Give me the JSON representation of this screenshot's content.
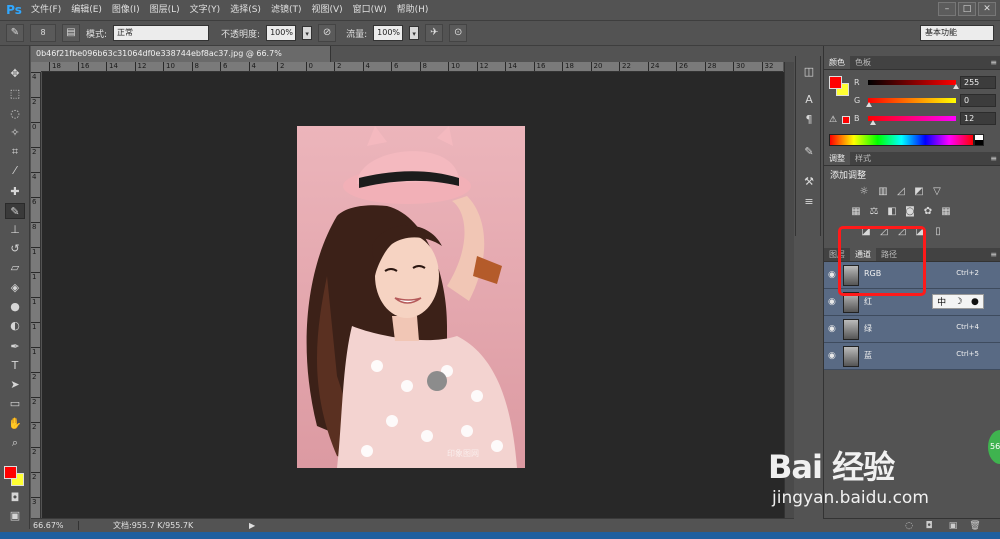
{
  "app": {
    "logo": "Ps"
  },
  "menu": [
    "文件(F)",
    "编辑(E)",
    "图像(I)",
    "图层(L)",
    "文字(Y)",
    "选择(S)",
    "滤镜(T)",
    "视图(V)",
    "窗口(W)",
    "帮助(H)"
  ],
  "window_controls": [
    "–",
    "□",
    "✕"
  ],
  "options": {
    "brush_size": "8",
    "mode_label": "模式:",
    "mode_value": "正常",
    "opacity_label": "不透明度:",
    "opacity_value": "100%",
    "flow_label": "流量:",
    "flow_value": "100%",
    "workspace": "基本功能"
  },
  "document": {
    "tab_title": "0b46f21fbe096b63c31064df0e338744ebf8ac37.jpg @ 66.7%(RGB/8#)",
    "tab_close": "×",
    "ruler_h": [
      "18",
      "16",
      "14",
      "12",
      "10",
      "8",
      "6",
      "4",
      "2",
      "0",
      "2",
      "4",
      "6",
      "8",
      "10",
      "12",
      "14",
      "16",
      "18",
      "20",
      "22",
      "24",
      "26",
      "28",
      "30",
      "32"
    ],
    "ruler_v": [
      "4",
      "2",
      "0",
      "2",
      "4",
      "6",
      "8",
      "1",
      "1",
      "1",
      "1",
      "1",
      "2",
      "2",
      "2",
      "2",
      "2",
      "3"
    ],
    "photo_watermark": "印象图网"
  },
  "status": {
    "zoom": "66.67%",
    "doc_info": "文档:955.7 K/955.7K",
    "arrow": "▶"
  },
  "color_panel": {
    "tabs": [
      "颜色",
      "色板"
    ],
    "sliders": [
      {
        "letter": "R",
        "value": "255"
      },
      {
        "letter": "G",
        "value": "0"
      },
      {
        "letter": "B",
        "value": "12"
      }
    ],
    "fg": "#ff0000",
    "bg": "#ffff33"
  },
  "adjust_panel": {
    "tabs": [
      "调整",
      "样式"
    ],
    "title": "添加调整"
  },
  "channels_panel": {
    "tabs": [
      "图层",
      "通道",
      "路径"
    ],
    "channels": [
      {
        "name": "RGB",
        "shortcut": "Ctrl+2"
      },
      {
        "name": "红",
        "shortcut": ""
      },
      {
        "name": "绿",
        "shortcut": "Ctrl+4"
      },
      {
        "name": "蓝",
        "shortcut": "Ctrl+5"
      }
    ]
  },
  "ime": {
    "label": "中"
  },
  "watermark": {
    "logo": "Bai 经验",
    "url": "jingyan.baidu.com"
  },
  "float_badge": "56"
}
